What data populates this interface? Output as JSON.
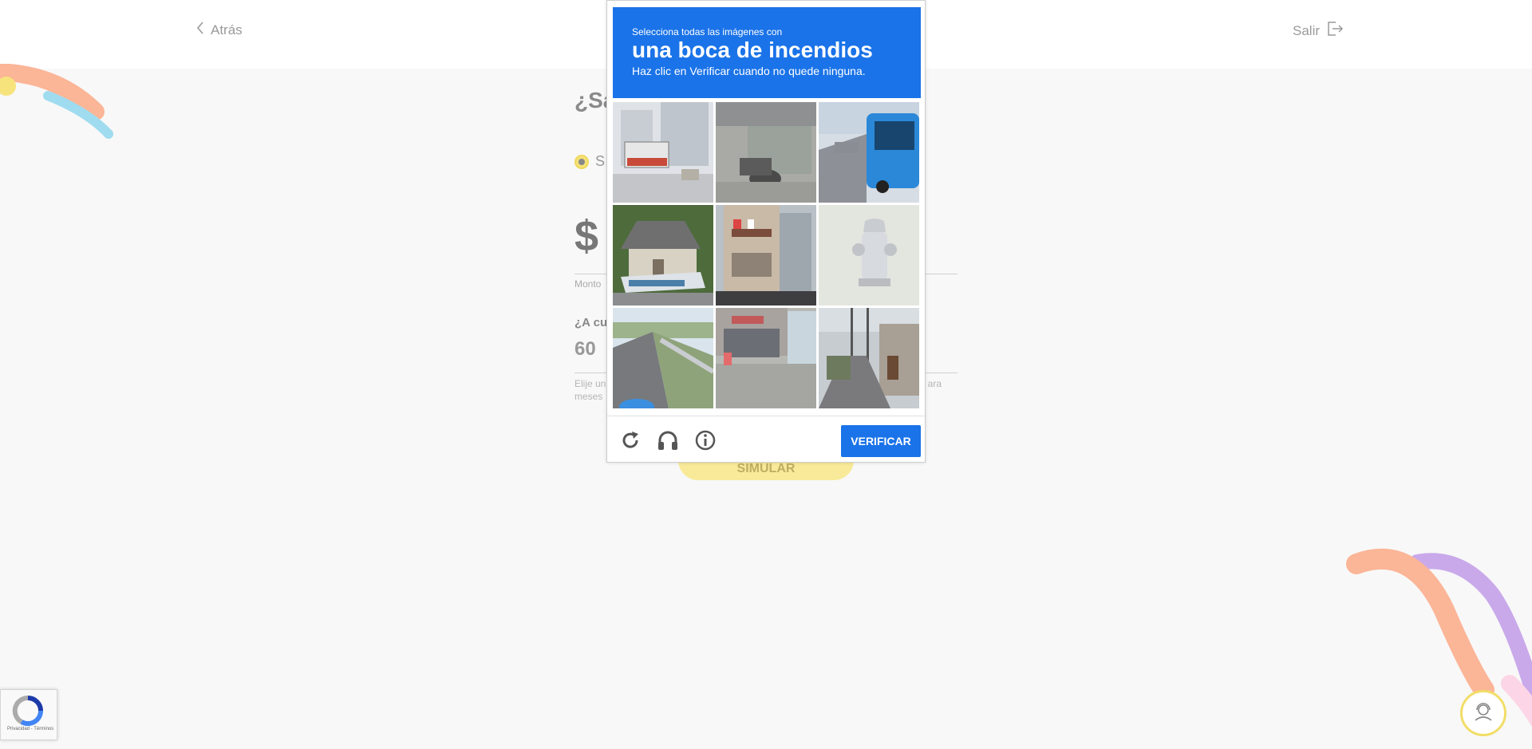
{
  "nav": {
    "back_label": "Atrás",
    "exit_label": "Salir"
  },
  "form": {
    "title": "¿Sa",
    "radio_label": "S",
    "amount": "$",
    "amount_label": "Monto",
    "question": "¿A cu",
    "months": "60",
    "help_left_line1": "Elije un",
    "help_left_line2": "meses",
    "help_right": "ara",
    "button_label": "SIMULAR"
  },
  "captcha": {
    "instruction_line1": "Selecciona todas las imágenes con",
    "target_object": "una boca de incendios",
    "instruction_line3": "Haz clic en Verificar cuando no quede ninguna.",
    "verify_label": "VERIFICAR",
    "tiles": [
      {
        "name": "tile-street-bus-buildings"
      },
      {
        "name": "tile-motorcycle-shelter"
      },
      {
        "name": "tile-blue-bus-road"
      },
      {
        "name": "tile-house-boat"
      },
      {
        "name": "tile-apartment-building"
      },
      {
        "name": "tile-fire-hydrant"
      },
      {
        "name": "tile-highway-guardrail"
      },
      {
        "name": "tile-storefront-bus"
      },
      {
        "name": "tile-narrow-street-poles"
      }
    ]
  },
  "badge": {
    "text": "Privacidad - Términos"
  },
  "colors": {
    "captcha_blue": "#1a73e8",
    "accent_yellow": "#f2dd68",
    "background": "#f8f8f8"
  }
}
